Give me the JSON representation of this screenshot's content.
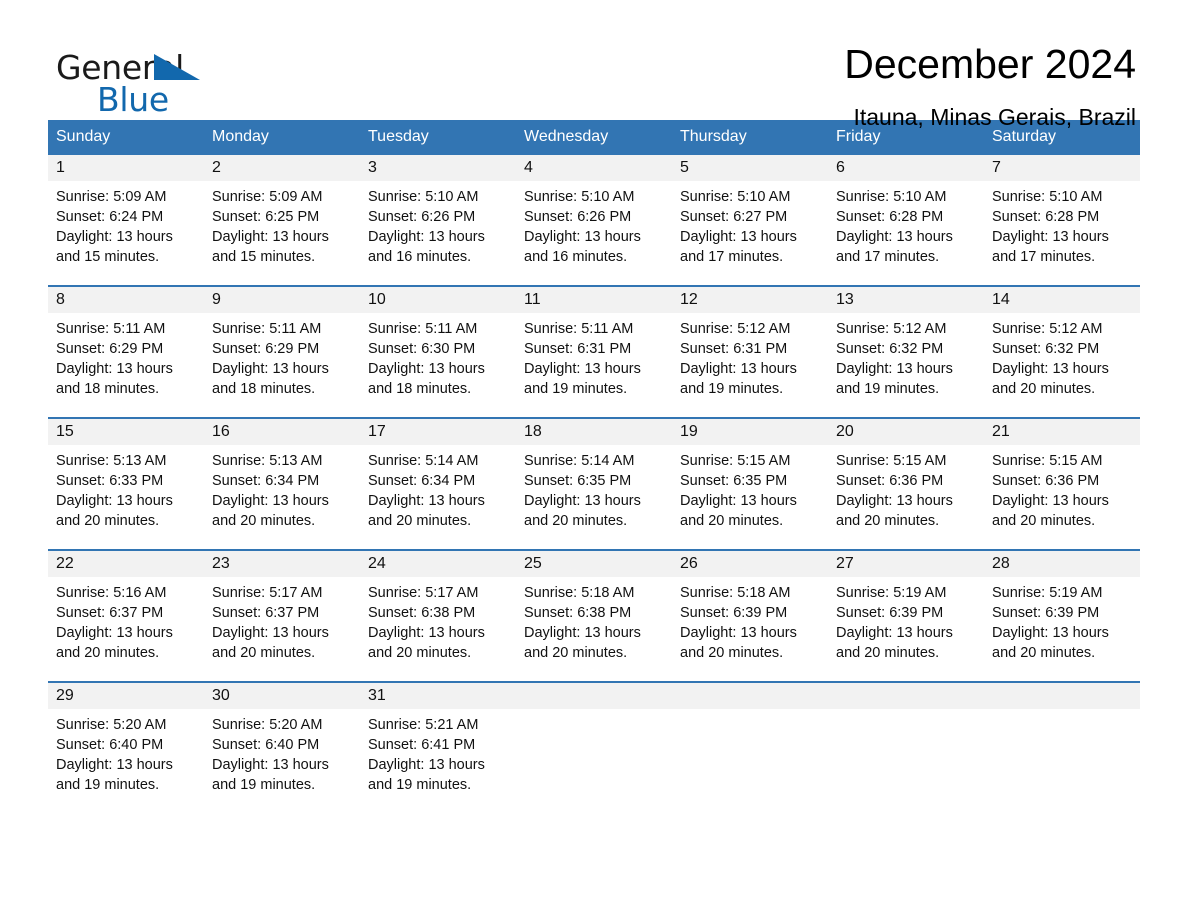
{
  "brand": {
    "name_part1": "General",
    "name_part2": "Blue",
    "accent_color": "#1268ad"
  },
  "header": {
    "title": "December 2024",
    "subtitle": "Itauna, Minas Gerais, Brazil"
  },
  "calendar": {
    "header_bg": "#3275b3",
    "daynum_bg": "#f2f2f2",
    "weekdays": [
      "Sunday",
      "Monday",
      "Tuesday",
      "Wednesday",
      "Thursday",
      "Friday",
      "Saturday"
    ],
    "weeks": [
      [
        {
          "day": "1",
          "sunrise": "Sunrise: 5:09 AM",
          "sunset": "Sunset: 6:24 PM",
          "daylight_line1": "Daylight: 13 hours",
          "daylight_line2": "and 15 minutes."
        },
        {
          "day": "2",
          "sunrise": "Sunrise: 5:09 AM",
          "sunset": "Sunset: 6:25 PM",
          "daylight_line1": "Daylight: 13 hours",
          "daylight_line2": "and 15 minutes."
        },
        {
          "day": "3",
          "sunrise": "Sunrise: 5:10 AM",
          "sunset": "Sunset: 6:26 PM",
          "daylight_line1": "Daylight: 13 hours",
          "daylight_line2": "and 16 minutes."
        },
        {
          "day": "4",
          "sunrise": "Sunrise: 5:10 AM",
          "sunset": "Sunset: 6:26 PM",
          "daylight_line1": "Daylight: 13 hours",
          "daylight_line2": "and 16 minutes."
        },
        {
          "day": "5",
          "sunrise": "Sunrise: 5:10 AM",
          "sunset": "Sunset: 6:27 PM",
          "daylight_line1": "Daylight: 13 hours",
          "daylight_line2": "and 17 minutes."
        },
        {
          "day": "6",
          "sunrise": "Sunrise: 5:10 AM",
          "sunset": "Sunset: 6:28 PM",
          "daylight_line1": "Daylight: 13 hours",
          "daylight_line2": "and 17 minutes."
        },
        {
          "day": "7",
          "sunrise": "Sunrise: 5:10 AM",
          "sunset": "Sunset: 6:28 PM",
          "daylight_line1": "Daylight: 13 hours",
          "daylight_line2": "and 17 minutes."
        }
      ],
      [
        {
          "day": "8",
          "sunrise": "Sunrise: 5:11 AM",
          "sunset": "Sunset: 6:29 PM",
          "daylight_line1": "Daylight: 13 hours",
          "daylight_line2": "and 18 minutes."
        },
        {
          "day": "9",
          "sunrise": "Sunrise: 5:11 AM",
          "sunset": "Sunset: 6:29 PM",
          "daylight_line1": "Daylight: 13 hours",
          "daylight_line2": "and 18 minutes."
        },
        {
          "day": "10",
          "sunrise": "Sunrise: 5:11 AM",
          "sunset": "Sunset: 6:30 PM",
          "daylight_line1": "Daylight: 13 hours",
          "daylight_line2": "and 18 minutes."
        },
        {
          "day": "11",
          "sunrise": "Sunrise: 5:11 AM",
          "sunset": "Sunset: 6:31 PM",
          "daylight_line1": "Daylight: 13 hours",
          "daylight_line2": "and 19 minutes."
        },
        {
          "day": "12",
          "sunrise": "Sunrise: 5:12 AM",
          "sunset": "Sunset: 6:31 PM",
          "daylight_line1": "Daylight: 13 hours",
          "daylight_line2": "and 19 minutes."
        },
        {
          "day": "13",
          "sunrise": "Sunrise: 5:12 AM",
          "sunset": "Sunset: 6:32 PM",
          "daylight_line1": "Daylight: 13 hours",
          "daylight_line2": "and 19 minutes."
        },
        {
          "day": "14",
          "sunrise": "Sunrise: 5:12 AM",
          "sunset": "Sunset: 6:32 PM",
          "daylight_line1": "Daylight: 13 hours",
          "daylight_line2": "and 20 minutes."
        }
      ],
      [
        {
          "day": "15",
          "sunrise": "Sunrise: 5:13 AM",
          "sunset": "Sunset: 6:33 PM",
          "daylight_line1": "Daylight: 13 hours",
          "daylight_line2": "and 20 minutes."
        },
        {
          "day": "16",
          "sunrise": "Sunrise: 5:13 AM",
          "sunset": "Sunset: 6:34 PM",
          "daylight_line1": "Daylight: 13 hours",
          "daylight_line2": "and 20 minutes."
        },
        {
          "day": "17",
          "sunrise": "Sunrise: 5:14 AM",
          "sunset": "Sunset: 6:34 PM",
          "daylight_line1": "Daylight: 13 hours",
          "daylight_line2": "and 20 minutes."
        },
        {
          "day": "18",
          "sunrise": "Sunrise: 5:14 AM",
          "sunset": "Sunset: 6:35 PM",
          "daylight_line1": "Daylight: 13 hours",
          "daylight_line2": "and 20 minutes."
        },
        {
          "day": "19",
          "sunrise": "Sunrise: 5:15 AM",
          "sunset": "Sunset: 6:35 PM",
          "daylight_line1": "Daylight: 13 hours",
          "daylight_line2": "and 20 minutes."
        },
        {
          "day": "20",
          "sunrise": "Sunrise: 5:15 AM",
          "sunset": "Sunset: 6:36 PM",
          "daylight_line1": "Daylight: 13 hours",
          "daylight_line2": "and 20 minutes."
        },
        {
          "day": "21",
          "sunrise": "Sunrise: 5:15 AM",
          "sunset": "Sunset: 6:36 PM",
          "daylight_line1": "Daylight: 13 hours",
          "daylight_line2": "and 20 minutes."
        }
      ],
      [
        {
          "day": "22",
          "sunrise": "Sunrise: 5:16 AM",
          "sunset": "Sunset: 6:37 PM",
          "daylight_line1": "Daylight: 13 hours",
          "daylight_line2": "and 20 minutes."
        },
        {
          "day": "23",
          "sunrise": "Sunrise: 5:17 AM",
          "sunset": "Sunset: 6:37 PM",
          "daylight_line1": "Daylight: 13 hours",
          "daylight_line2": "and 20 minutes."
        },
        {
          "day": "24",
          "sunrise": "Sunrise: 5:17 AM",
          "sunset": "Sunset: 6:38 PM",
          "daylight_line1": "Daylight: 13 hours",
          "daylight_line2": "and 20 minutes."
        },
        {
          "day": "25",
          "sunrise": "Sunrise: 5:18 AM",
          "sunset": "Sunset: 6:38 PM",
          "daylight_line1": "Daylight: 13 hours",
          "daylight_line2": "and 20 minutes."
        },
        {
          "day": "26",
          "sunrise": "Sunrise: 5:18 AM",
          "sunset": "Sunset: 6:39 PM",
          "daylight_line1": "Daylight: 13 hours",
          "daylight_line2": "and 20 minutes."
        },
        {
          "day": "27",
          "sunrise": "Sunrise: 5:19 AM",
          "sunset": "Sunset: 6:39 PM",
          "daylight_line1": "Daylight: 13 hours",
          "daylight_line2": "and 20 minutes."
        },
        {
          "day": "28",
          "sunrise": "Sunrise: 5:19 AM",
          "sunset": "Sunset: 6:39 PM",
          "daylight_line1": "Daylight: 13 hours",
          "daylight_line2": "and 20 minutes."
        }
      ],
      [
        {
          "day": "29",
          "sunrise": "Sunrise: 5:20 AM",
          "sunset": "Sunset: 6:40 PM",
          "daylight_line1": "Daylight: 13 hours",
          "daylight_line2": "and 19 minutes."
        },
        {
          "day": "30",
          "sunrise": "Sunrise: 5:20 AM",
          "sunset": "Sunset: 6:40 PM",
          "daylight_line1": "Daylight: 13 hours",
          "daylight_line2": "and 19 minutes."
        },
        {
          "day": "31",
          "sunrise": "Sunrise: 5:21 AM",
          "sunset": "Sunset: 6:41 PM",
          "daylight_line1": "Daylight: 13 hours",
          "daylight_line2": "and 19 minutes."
        },
        {
          "day": "",
          "sunrise": "",
          "sunset": "",
          "daylight_line1": "",
          "daylight_line2": ""
        },
        {
          "day": "",
          "sunrise": "",
          "sunset": "",
          "daylight_line1": "",
          "daylight_line2": ""
        },
        {
          "day": "",
          "sunrise": "",
          "sunset": "",
          "daylight_line1": "",
          "daylight_line2": ""
        },
        {
          "day": "",
          "sunrise": "",
          "sunset": "",
          "daylight_line1": "",
          "daylight_line2": ""
        }
      ]
    ]
  }
}
